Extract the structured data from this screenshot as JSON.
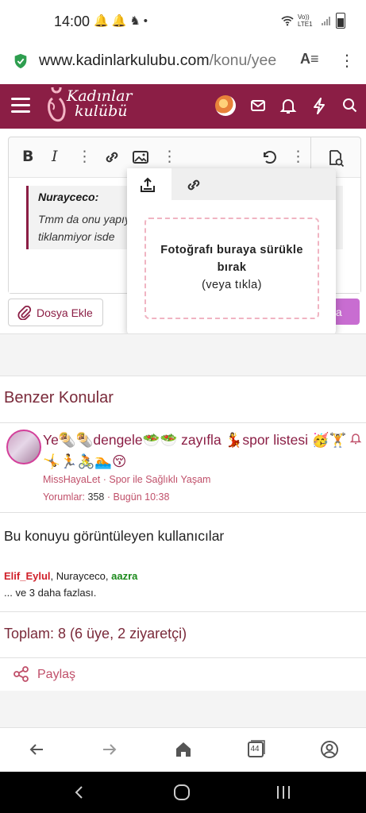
{
  "status_bar": {
    "time": "14:00",
    "left_icons": "🔔🔔♞•",
    "network": "Vo)) LTE1"
  },
  "browser": {
    "url_domain": "www.kadinlarkulubu.com",
    "url_path": "/konu/yee",
    "tab_count": "44"
  },
  "header": {
    "logo_line1": "Kadınlar",
    "logo_line2": "kulübü"
  },
  "editor": {
    "quote_author": "Nurayceco:",
    "quote_line1": "Tmm da onu yapıy",
    "quote_line2": "tiklanmiyor isde"
  },
  "upload_popup": {
    "dropzone_title": "Fotoğrafı buraya sürükle bırak",
    "dropzone_sub": "(veya tıkla)"
  },
  "actions": {
    "attach_label": "Dosya Ekle",
    "reply_partial": "ola"
  },
  "similar": {
    "title": "Benzer Konular",
    "thread": {
      "title": "Ye🌯🌯dengele🥗🥗 zayıfla 💃spor listesi 🥳🏋🤸🏃🚴🏊😚",
      "author": "MissHayaLet",
      "forum": "Spor ile Sağlıklı Yaşam",
      "replies_label": "Yorumlar:",
      "replies": "358",
      "date": "Bugün 10:38"
    }
  },
  "viewers": {
    "title": "Bu konuyu görüntüleyen kullanıcılar",
    "user1": "Elif_Eylul",
    "user2": "Nurayceco",
    "user3": "aazra",
    "more": "... ve 3 daha fazlası."
  },
  "total": "Toplam: 8 (6 üye, 2 ziyaretçi)",
  "share_label": "Paylaş",
  "colors": {
    "brand": "#8b1e45",
    "accent_link": "#c0506a",
    "reply_button": "#c86dd1"
  },
  "icons": [
    "lock-icon",
    "reader-mode-icon",
    "menu-dots-icon",
    "hamburger-icon",
    "mail-icon",
    "bell-icon",
    "bolt-icon",
    "search-icon",
    "bold-icon",
    "italic-icon",
    "link-icon",
    "image-icon",
    "undo-icon",
    "preview-icon",
    "upload-icon",
    "paperclip-icon",
    "share-icon",
    "back-icon",
    "forward-icon",
    "home-icon",
    "tabs-icon",
    "account-icon"
  ]
}
